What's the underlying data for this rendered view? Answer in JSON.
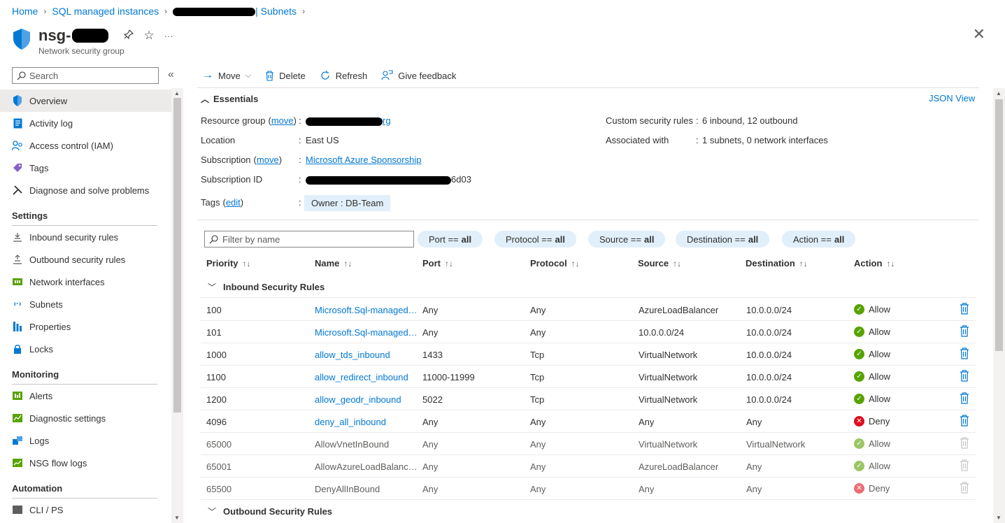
{
  "breadcrumb": {
    "home": "Home",
    "sql_instances": "SQL managed instances",
    "subnets": "| Subnets"
  },
  "header": {
    "title": "nsg-",
    "subtitle": "Network security group",
    "pin": "pin-icon",
    "star": "star-icon",
    "more": "···",
    "close": "✕"
  },
  "sidebar": {
    "search_placeholder": "Search",
    "collapse": "«",
    "items": [
      {
        "label": "Overview",
        "icon": "shield-icon"
      },
      {
        "label": "Activity log",
        "icon": "activity-log-icon"
      },
      {
        "label": "Access control (IAM)",
        "icon": "iam-icon"
      },
      {
        "label": "Tags",
        "icon": "tag-icon"
      },
      {
        "label": "Diagnose and solve problems",
        "icon": "wrench-icon"
      }
    ],
    "settings_title": "Settings",
    "settings": [
      {
        "label": "Inbound security rules",
        "icon": "inbound-icon"
      },
      {
        "label": "Outbound security rules",
        "icon": "outbound-icon"
      },
      {
        "label": "Network interfaces",
        "icon": "nic-icon"
      },
      {
        "label": "Subnets",
        "icon": "subnet-icon"
      },
      {
        "label": "Properties",
        "icon": "properties-icon"
      },
      {
        "label": "Locks",
        "icon": "lock-icon"
      }
    ],
    "monitoring_title": "Monitoring",
    "monitoring": [
      {
        "label": "Alerts",
        "icon": "alerts-icon"
      },
      {
        "label": "Diagnostic settings",
        "icon": "diagnostic-icon"
      },
      {
        "label": "Logs",
        "icon": "logs-icon"
      },
      {
        "label": "NSG flow logs",
        "icon": "flow-logs-icon"
      }
    ],
    "automation_title": "Automation",
    "automation": [
      {
        "label": "CLI / PS",
        "icon": "cli-icon"
      }
    ]
  },
  "toolbar": {
    "move": "Move",
    "delete": "Delete",
    "refresh": "Refresh",
    "feedback": "Give feedback"
  },
  "essentials": {
    "title": "Essentials",
    "json_view": "JSON View",
    "resource_group_label": "Resource group",
    "resource_group_move": "move",
    "resource_group_value_suffix": "rg",
    "location_label": "Location",
    "location_value": "East US",
    "subscription_label": "Subscription",
    "subscription_move": "move",
    "subscription_value": "Microsoft Azure Sponsorship",
    "subscription_id_label": "Subscription ID",
    "subscription_id_suffix": "6d03",
    "tags_label": "Tags",
    "tags_edit": "edit",
    "tag_chip": "Owner : DB-Team",
    "custom_rules_label": "Custom security rules",
    "custom_rules_value": "6 inbound, 12 outbound",
    "associated_label": "Associated with",
    "associated_value": "1 subnets, 0 network interfaces"
  },
  "filters": {
    "placeholder": "Filter by name",
    "pills": [
      {
        "key": "Port ==",
        "val": "all"
      },
      {
        "key": "Protocol ==",
        "val": "all"
      },
      {
        "key": "Source ==",
        "val": "all"
      },
      {
        "key": "Destination ==",
        "val": "all"
      },
      {
        "key": "Action ==",
        "val": "all"
      }
    ]
  },
  "table": {
    "columns": [
      "Priority",
      "Name",
      "Port",
      "Protocol",
      "Source",
      "Destination",
      "Action"
    ],
    "inbound_title": "Inbound Security Rules",
    "outbound_title": "Outbound Security Rules",
    "rows": [
      {
        "priority": "100",
        "name": "Microsoft.Sql-managed…",
        "port": "Any",
        "protocol": "Any",
        "source": "AzureLoadBalancer",
        "destination": "10.0.0.0/24",
        "action": "Allow",
        "default": false
      },
      {
        "priority": "101",
        "name": "Microsoft.Sql-managed…",
        "port": "Any",
        "protocol": "Any",
        "source": "10.0.0.0/24",
        "destination": "10.0.0.0/24",
        "action": "Allow",
        "default": false
      },
      {
        "priority": "1000",
        "name": "allow_tds_inbound",
        "port": "1433",
        "protocol": "Tcp",
        "source": "VirtualNetwork",
        "destination": "10.0.0.0/24",
        "action": "Allow",
        "default": false
      },
      {
        "priority": "1100",
        "name": "allow_redirect_inbound",
        "port": "11000-11999",
        "protocol": "Tcp",
        "source": "VirtualNetwork",
        "destination": "10.0.0.0/24",
        "action": "Allow",
        "default": false
      },
      {
        "priority": "1200",
        "name": "allow_geodr_inbound",
        "port": "5022",
        "protocol": "Tcp",
        "source": "VirtualNetwork",
        "destination": "10.0.0.0/24",
        "action": "Allow",
        "default": false
      },
      {
        "priority": "4096",
        "name": "deny_all_inbound",
        "port": "Any",
        "protocol": "Any",
        "source": "Any",
        "destination": "Any",
        "action": "Deny",
        "default": false
      },
      {
        "priority": "65000",
        "name": "AllowVnetInBound",
        "port": "Any",
        "protocol": "Any",
        "source": "VirtualNetwork",
        "destination": "VirtualNetwork",
        "action": "Allow",
        "default": true
      },
      {
        "priority": "65001",
        "name": "AllowAzureLoadBalanc…",
        "port": "Any",
        "protocol": "Any",
        "source": "AzureLoadBalancer",
        "destination": "Any",
        "action": "Allow",
        "default": true
      },
      {
        "priority": "65500",
        "name": "DenyAllInBound",
        "port": "Any",
        "protocol": "Any",
        "source": "Any",
        "destination": "Any",
        "action": "Deny",
        "default": true
      }
    ]
  },
  "colors": {
    "accent": "#0078d4",
    "allow": "#57a300",
    "deny": "#e00b1c"
  }
}
